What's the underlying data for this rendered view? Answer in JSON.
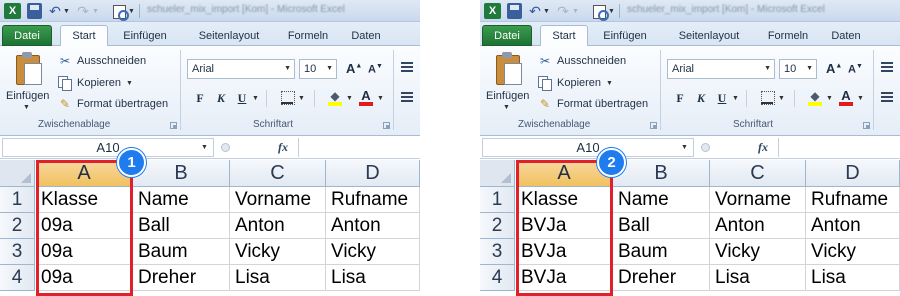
{
  "panes": [
    {
      "id": "left",
      "badge": "1",
      "titlebar": {
        "window_title": "schueler_mix_import [Kom] - Microsoft Excel"
      },
      "tabs": {
        "datei": "Datei",
        "start": "Start",
        "einfuegen": "Einfügen",
        "seitenlayout": "Seitenlayout",
        "formeln": "Formeln",
        "daten": "Daten"
      },
      "ribbon": {
        "paste_label": "Einfügen",
        "cut": "Ausschneiden",
        "copy": "Kopieren",
        "format_painter": "Format übertragen",
        "clipboard_group": "Zwischenablage",
        "font_group": "Schriftart",
        "font_name": "Arial",
        "font_size": "10"
      },
      "namebox": "A10",
      "columns": [
        "A",
        "B",
        "C",
        "D"
      ],
      "rows": [
        {
          "num": "1",
          "cells": [
            "Klasse",
            "Name",
            "Vorname",
            "Rufname"
          ]
        },
        {
          "num": "2",
          "cells": [
            "09a",
            "Ball",
            "Anton",
            "Anton"
          ]
        },
        {
          "num": "3",
          "cells": [
            "09a",
            "Baum",
            "Vicky",
            "Vicky"
          ]
        },
        {
          "num": "4",
          "cells": [
            "09a",
            "Dreher",
            "Lisa",
            "Lisa"
          ]
        }
      ]
    },
    {
      "id": "right",
      "badge": "2",
      "titlebar": {
        "window_title": "schueler_mix_import [Kom] - Microsoft Excel"
      },
      "tabs": {
        "datei": "Datei",
        "start": "Start",
        "einfuegen": "Einfügen",
        "seitenlayout": "Seitenlayout",
        "formeln": "Formeln",
        "daten": "Daten"
      },
      "ribbon": {
        "paste_label": "Einfügen",
        "cut": "Ausschneiden",
        "copy": "Kopieren",
        "format_painter": "Format übertragen",
        "clipboard_group": "Zwischenablage",
        "font_group": "Schriftart",
        "font_name": "Arial",
        "font_size": "10"
      },
      "namebox": "A10",
      "columns": [
        "A",
        "B",
        "C",
        "D"
      ],
      "rows": [
        {
          "num": "1",
          "cells": [
            "Klasse",
            "Name",
            "Vorname",
            "Rufname"
          ]
        },
        {
          "num": "2",
          "cells": [
            "BVJa",
            "Ball",
            "Anton",
            "Anton"
          ]
        },
        {
          "num": "3",
          "cells": [
            "BVJa",
            "Baum",
            "Vicky",
            "Vicky"
          ]
        },
        {
          "num": "4",
          "cells": [
            "BVJa",
            "Dreher",
            "Lisa",
            "Lisa"
          ]
        }
      ]
    }
  ],
  "colors": {
    "highlight": "#e0202a",
    "badge": "#1e7bf0",
    "datei_tab": "#1d7332",
    "selected_col_header": "#f1c15f"
  },
  "icons": [
    "excel-logo-icon",
    "save-icon",
    "undo-icon",
    "redo-icon",
    "print-preview-icon",
    "paste-icon",
    "scissors-icon",
    "copy-icon",
    "format-painter-icon",
    "grow-font-icon",
    "shrink-font-icon",
    "bold-icon",
    "italic-icon",
    "underline-icon",
    "borders-icon",
    "fill-color-icon",
    "font-color-icon",
    "align-icon",
    "fx-icon"
  ]
}
